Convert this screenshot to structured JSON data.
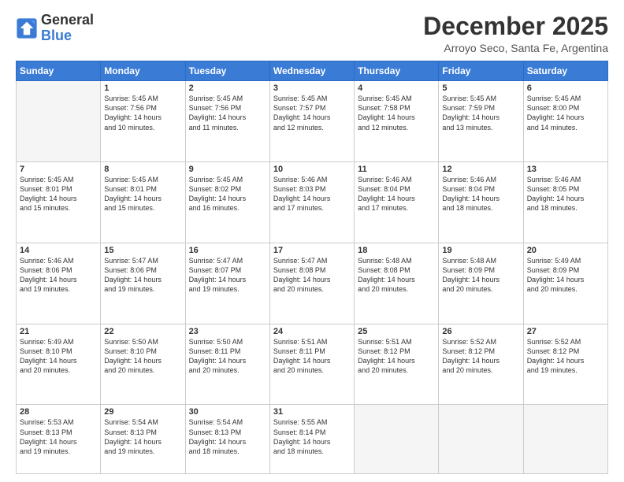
{
  "logo": {
    "text_general": "General",
    "text_blue": "Blue"
  },
  "header": {
    "month": "December 2025",
    "location": "Arroyo Seco, Santa Fe, Argentina"
  },
  "weekdays": [
    "Sunday",
    "Monday",
    "Tuesday",
    "Wednesday",
    "Thursday",
    "Friday",
    "Saturday"
  ],
  "weeks": [
    [
      {
        "day": "",
        "info": ""
      },
      {
        "day": "1",
        "info": "Sunrise: 5:45 AM\nSunset: 7:56 PM\nDaylight: 14 hours\nand 10 minutes."
      },
      {
        "day": "2",
        "info": "Sunrise: 5:45 AM\nSunset: 7:56 PM\nDaylight: 14 hours\nand 11 minutes."
      },
      {
        "day": "3",
        "info": "Sunrise: 5:45 AM\nSunset: 7:57 PM\nDaylight: 14 hours\nand 12 minutes."
      },
      {
        "day": "4",
        "info": "Sunrise: 5:45 AM\nSunset: 7:58 PM\nDaylight: 14 hours\nand 12 minutes."
      },
      {
        "day": "5",
        "info": "Sunrise: 5:45 AM\nSunset: 7:59 PM\nDaylight: 14 hours\nand 13 minutes."
      },
      {
        "day": "6",
        "info": "Sunrise: 5:45 AM\nSunset: 8:00 PM\nDaylight: 14 hours\nand 14 minutes."
      }
    ],
    [
      {
        "day": "7",
        "info": "Sunrise: 5:45 AM\nSunset: 8:01 PM\nDaylight: 14 hours\nand 15 minutes."
      },
      {
        "day": "8",
        "info": "Sunrise: 5:45 AM\nSunset: 8:01 PM\nDaylight: 14 hours\nand 15 minutes."
      },
      {
        "day": "9",
        "info": "Sunrise: 5:45 AM\nSunset: 8:02 PM\nDaylight: 14 hours\nand 16 minutes."
      },
      {
        "day": "10",
        "info": "Sunrise: 5:46 AM\nSunset: 8:03 PM\nDaylight: 14 hours\nand 17 minutes."
      },
      {
        "day": "11",
        "info": "Sunrise: 5:46 AM\nSunset: 8:04 PM\nDaylight: 14 hours\nand 17 minutes."
      },
      {
        "day": "12",
        "info": "Sunrise: 5:46 AM\nSunset: 8:04 PM\nDaylight: 14 hours\nand 18 minutes."
      },
      {
        "day": "13",
        "info": "Sunrise: 5:46 AM\nSunset: 8:05 PM\nDaylight: 14 hours\nand 18 minutes."
      }
    ],
    [
      {
        "day": "14",
        "info": "Sunrise: 5:46 AM\nSunset: 8:06 PM\nDaylight: 14 hours\nand 19 minutes."
      },
      {
        "day": "15",
        "info": "Sunrise: 5:47 AM\nSunset: 8:06 PM\nDaylight: 14 hours\nand 19 minutes."
      },
      {
        "day": "16",
        "info": "Sunrise: 5:47 AM\nSunset: 8:07 PM\nDaylight: 14 hours\nand 19 minutes."
      },
      {
        "day": "17",
        "info": "Sunrise: 5:47 AM\nSunset: 8:08 PM\nDaylight: 14 hours\nand 20 minutes."
      },
      {
        "day": "18",
        "info": "Sunrise: 5:48 AM\nSunset: 8:08 PM\nDaylight: 14 hours\nand 20 minutes."
      },
      {
        "day": "19",
        "info": "Sunrise: 5:48 AM\nSunset: 8:09 PM\nDaylight: 14 hours\nand 20 minutes."
      },
      {
        "day": "20",
        "info": "Sunrise: 5:49 AM\nSunset: 8:09 PM\nDaylight: 14 hours\nand 20 minutes."
      }
    ],
    [
      {
        "day": "21",
        "info": "Sunrise: 5:49 AM\nSunset: 8:10 PM\nDaylight: 14 hours\nand 20 minutes."
      },
      {
        "day": "22",
        "info": "Sunrise: 5:50 AM\nSunset: 8:10 PM\nDaylight: 14 hours\nand 20 minutes."
      },
      {
        "day": "23",
        "info": "Sunrise: 5:50 AM\nSunset: 8:11 PM\nDaylight: 14 hours\nand 20 minutes."
      },
      {
        "day": "24",
        "info": "Sunrise: 5:51 AM\nSunset: 8:11 PM\nDaylight: 14 hours\nand 20 minutes."
      },
      {
        "day": "25",
        "info": "Sunrise: 5:51 AM\nSunset: 8:12 PM\nDaylight: 14 hours\nand 20 minutes."
      },
      {
        "day": "26",
        "info": "Sunrise: 5:52 AM\nSunset: 8:12 PM\nDaylight: 14 hours\nand 20 minutes."
      },
      {
        "day": "27",
        "info": "Sunrise: 5:52 AM\nSunset: 8:12 PM\nDaylight: 14 hours\nand 19 minutes."
      }
    ],
    [
      {
        "day": "28",
        "info": "Sunrise: 5:53 AM\nSunset: 8:13 PM\nDaylight: 14 hours\nand 19 minutes."
      },
      {
        "day": "29",
        "info": "Sunrise: 5:54 AM\nSunset: 8:13 PM\nDaylight: 14 hours\nand 19 minutes."
      },
      {
        "day": "30",
        "info": "Sunrise: 5:54 AM\nSunset: 8:13 PM\nDaylight: 14 hours\nand 18 minutes."
      },
      {
        "day": "31",
        "info": "Sunrise: 5:55 AM\nSunset: 8:14 PM\nDaylight: 14 hours\nand 18 minutes."
      },
      {
        "day": "",
        "info": ""
      },
      {
        "day": "",
        "info": ""
      },
      {
        "day": "",
        "info": ""
      }
    ]
  ]
}
